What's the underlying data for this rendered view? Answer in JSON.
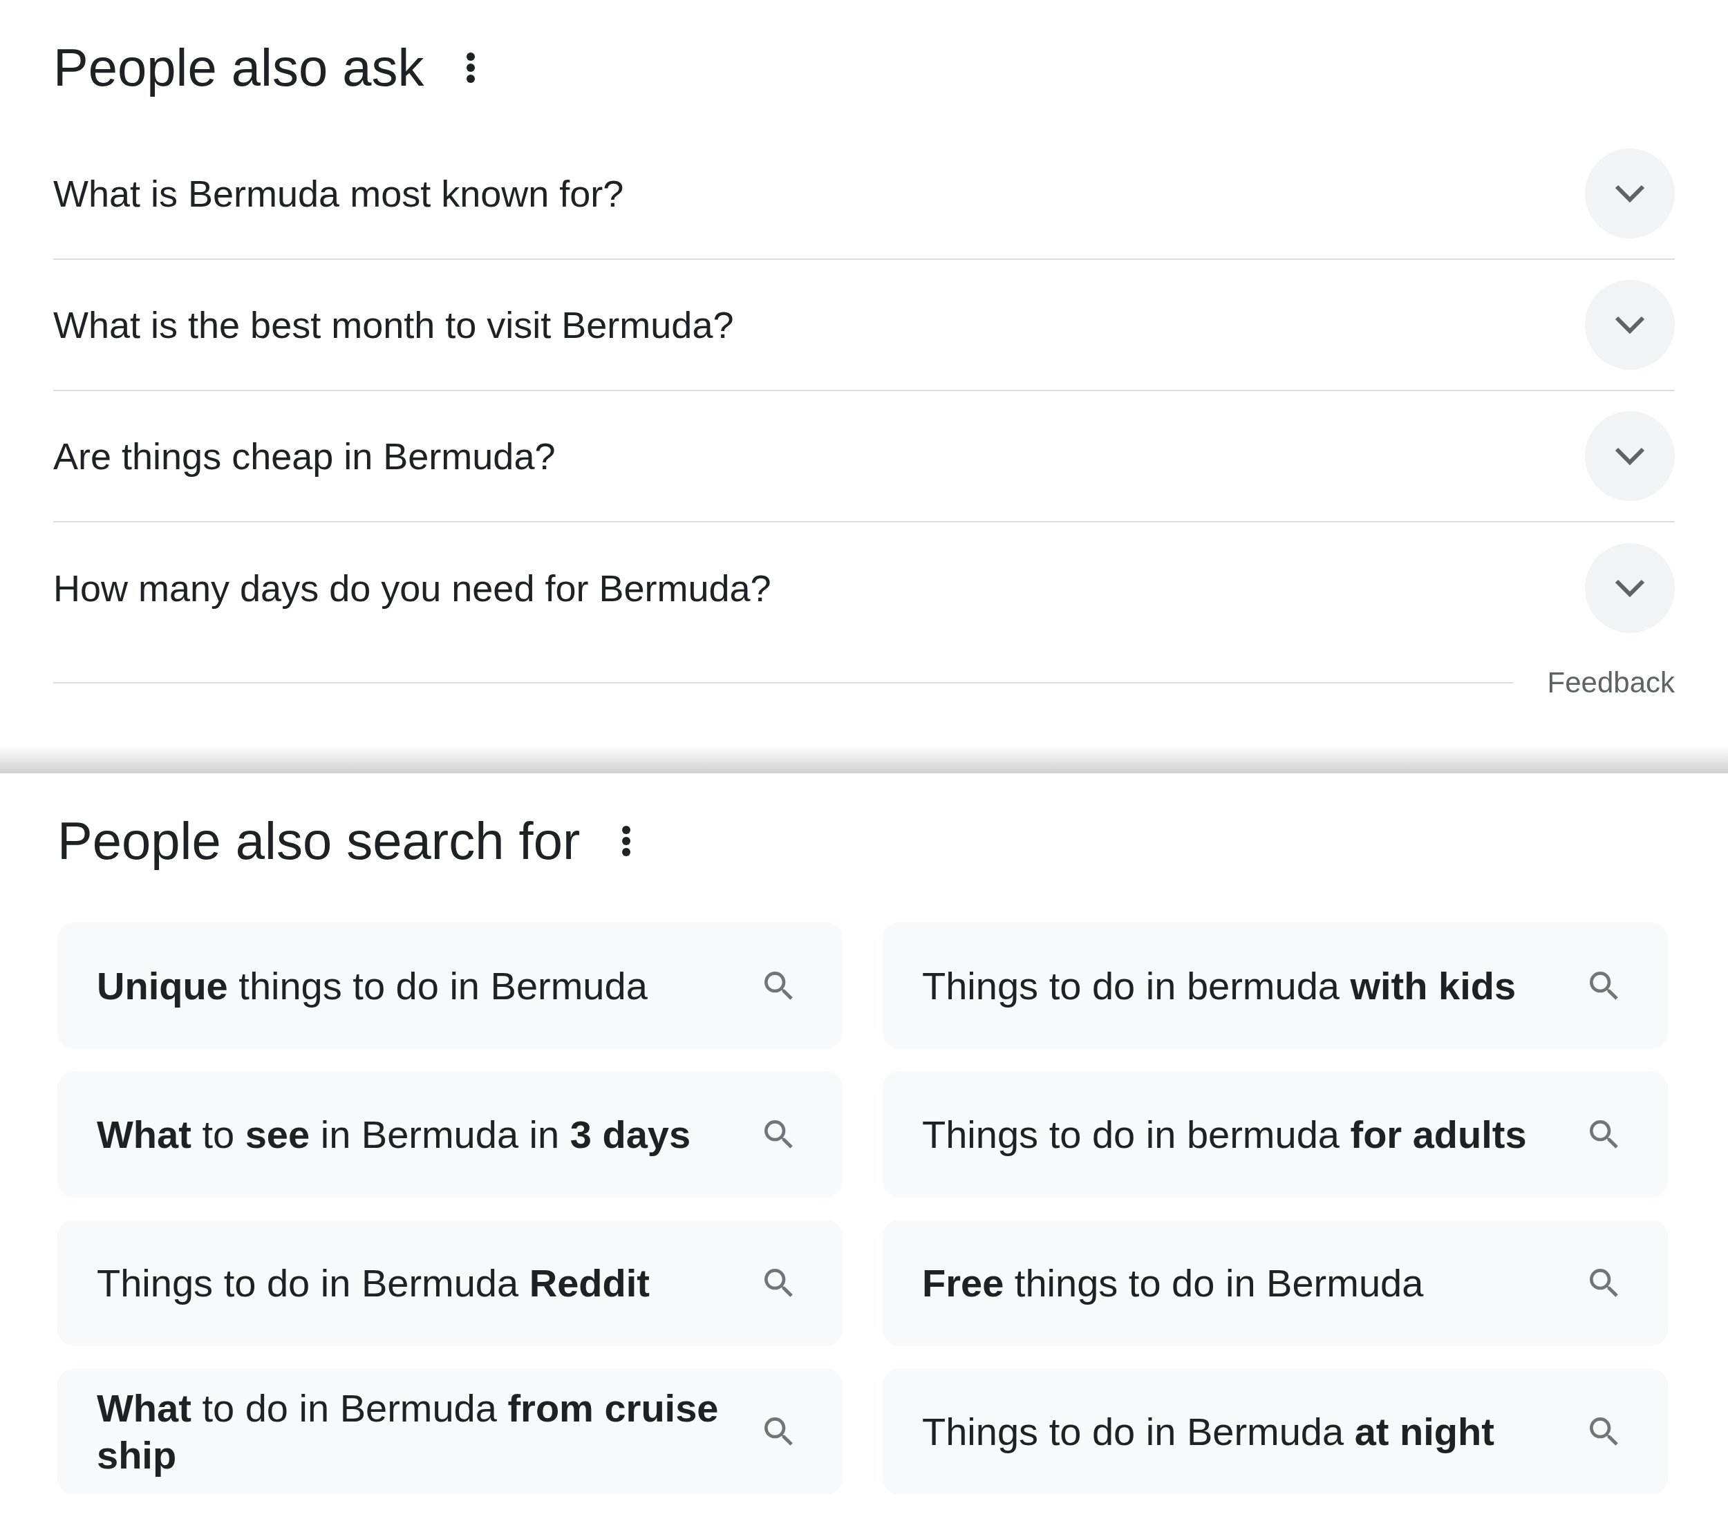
{
  "people_also_ask": {
    "title": "People also ask",
    "questions": [
      {
        "text": "What is Bermuda most known for?",
        "expanded": false
      },
      {
        "text": "What is the best month to visit Bermuda?",
        "expanded": false
      },
      {
        "text": "Are things cheap in Bermuda?",
        "expanded": false
      },
      {
        "text": "How many days do you need for Bermuda?",
        "expanded": false
      }
    ],
    "feedback": "Feedback"
  },
  "people_also_search_for": {
    "title": "People also search for",
    "suggestions": [
      "**Unique** things to do in Bermuda",
      "Things to do in bermuda **with kids**",
      "**What** to **see** in Bermuda in **3 days**",
      "Things to do in bermuda **for adults**",
      "Things to do in Bermuda **Reddit**",
      "**Free** things to do in Bermuda",
      "**What** to do in Bermuda **from cruise ship**",
      "Things to do in Bermuda **at night**"
    ]
  }
}
